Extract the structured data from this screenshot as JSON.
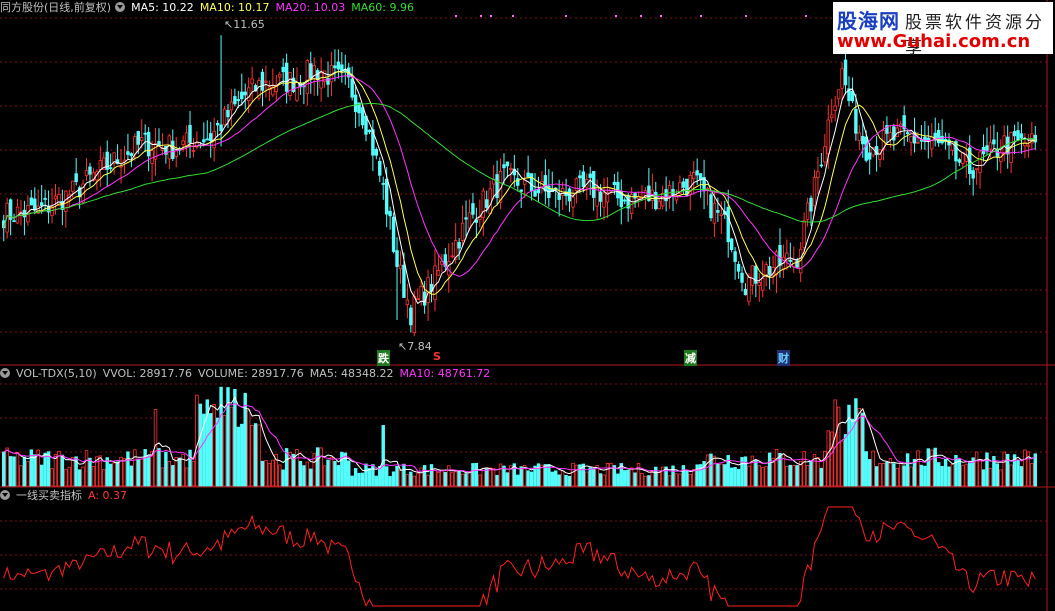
{
  "panel_main": {
    "title": "同方股份(日线,前复权)",
    "ma": [
      {
        "label": "MA5: 10.22",
        "color": "#ffffff"
      },
      {
        "label": "MA10: 10.17",
        "color": "#ffff55"
      },
      {
        "label": "MA20: 10.03",
        "color": "#ff33ff"
      },
      {
        "label": "MA60: 9.96",
        "color": "#33dd33"
      }
    ],
    "high_label": "11.65",
    "low_label": "7.84",
    "annotations": [
      {
        "text": "跌",
        "color": "#ffffff",
        "bg": "#1f7a1f"
      },
      {
        "text": "S",
        "color": "#ff3333",
        "bg": ""
      },
      {
        "text": "减",
        "color": "#ffffff",
        "bg": "#1f7a1f"
      },
      {
        "text": "财",
        "color": "#66ccff",
        "bg": "#203070"
      }
    ]
  },
  "panel_volume": {
    "title": "VOL-TDX(5,10)",
    "vvol": "VVOL: 28917.76",
    "volume": "VOLUME: 28917.76",
    "ma5": "MA5: 48348.22",
    "ma10": "MA10: 48761.72",
    "colors": {
      "label": "#c0c0c0",
      "ma10": "#ff33ff"
    }
  },
  "panel_indicator": {
    "title": "一线买卖指标",
    "value": "A: 0.37",
    "color": "#ff3333"
  },
  "logo": {
    "brand": "股海网",
    "tagline": "股票软件资源分享",
    "url": "www.Guhai.com.cn"
  },
  "colors": {
    "up": "#ff3232",
    "down": "#54fcfc",
    "grid": "#7a1010",
    "ma5": "#ffffff",
    "ma10": "#ffff55",
    "ma20": "#ff33ff",
    "ma60": "#33dd33",
    "indicator": "#ff2020"
  },
  "chart_data": {
    "type": "candlestick",
    "candles": {
      "count": 300,
      "price_high": 11.65,
      "price_low": 7.84,
      "control_closes": [
        [
          0,
          9.25
        ],
        [
          10,
          9.3
        ],
        [
          20,
          9.55
        ],
        [
          30,
          9.9
        ],
        [
          40,
          10.2
        ],
        [
          50,
          10.15
        ],
        [
          60,
          10.3
        ],
        [
          70,
          10.85
        ],
        [
          75,
          11.0
        ],
        [
          85,
          11.05
        ],
        [
          90,
          11.2
        ],
        [
          100,
          11.0
        ],
        [
          105,
          10.5
        ],
        [
          110,
          9.6
        ],
        [
          114,
          8.6
        ],
        [
          118,
          7.95
        ],
        [
          125,
          8.4
        ],
        [
          135,
          9.2
        ],
        [
          145,
          9.75
        ],
        [
          150,
          9.65
        ],
        [
          160,
          9.5
        ],
        [
          170,
          9.6
        ],
        [
          180,
          9.45
        ],
        [
          190,
          9.5
        ],
        [
          200,
          9.7
        ],
        [
          210,
          9.05
        ],
        [
          215,
          8.35
        ],
        [
          220,
          8.5
        ],
        [
          230,
          8.7
        ],
        [
          235,
          9.6
        ],
        [
          240,
          10.7
        ],
        [
          243,
          11.15
        ],
        [
          246,
          10.6
        ],
        [
          250,
          10.15
        ],
        [
          260,
          10.3
        ],
        [
          270,
          10.2
        ],
        [
          280,
          9.85
        ],
        [
          290,
          10.2
        ],
        [
          299,
          10.2
        ]
      ]
    },
    "ma_values": {
      "MA5": 10.22,
      "MA10": 10.17,
      "MA20": 10.03,
      "MA60": 9.96
    },
    "volume": {
      "vvol": 28917.76,
      "volume": 28917.76,
      "ma5": 48348.22,
      "ma10": 48761.72
    },
    "indicator": {
      "name": "一线买卖指标",
      "A": 0.37
    }
  }
}
